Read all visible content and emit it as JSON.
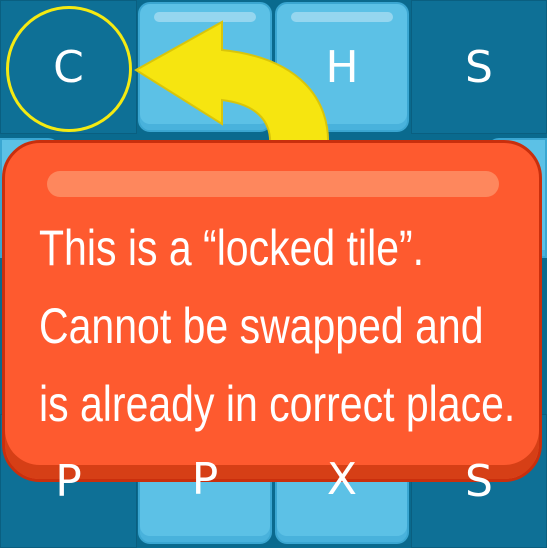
{
  "board": {
    "top_row": [
      {
        "letter": "C",
        "style": "locked"
      },
      {
        "letter": "",
        "style": "swappable"
      },
      {
        "letter": "H",
        "style": "swappable"
      },
      {
        "letter": "S",
        "style": "fixed"
      }
    ],
    "bottom_row": [
      {
        "letter": "P",
        "style": "fixed"
      },
      {
        "letter": "P",
        "style": "swappable"
      },
      {
        "letter": "X",
        "style": "swappable"
      },
      {
        "letter": "S",
        "style": "fixed"
      }
    ]
  },
  "tutorial": {
    "lines": [
      "This is a “locked tile”.",
      "Cannot be swapped and",
      "is already in correct place."
    ]
  },
  "colors": {
    "highlight_ring": "#f4ea12",
    "arrow": "#f6e510",
    "callout": "#fe5a2f",
    "tile_light": "#5cc1e6",
    "tile_dark": "#0e7096"
  },
  "icons": {
    "pointer": "curved-arrow-icon",
    "highlight": "locked-tile-highlight-ring"
  }
}
